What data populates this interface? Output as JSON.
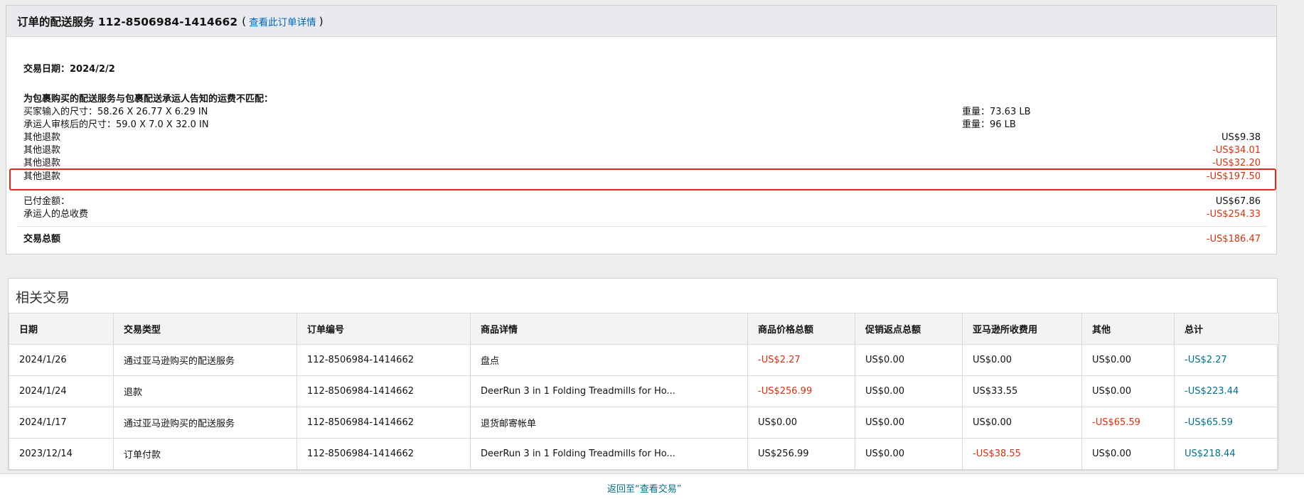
{
  "header": {
    "title": "订单的配送服务 112-8506984-1414662",
    "paren_open": "(",
    "link": "查看此订单详情",
    "paren_close": ")"
  },
  "summary": {
    "date_label": "交易日期：",
    "date_value": "2024/2/2",
    "mismatch_title": "为包裹购买的配送服务与包裹配送承运人告知的运费不匹配：",
    "buyer_dims": "买家输入的尺寸：58.26 X 26.77 X 6.29 IN",
    "buyer_weight": "重量：73.63 LB",
    "carrier_dims": "承运人审核后的尺寸：59.0 X 7.0 X 32.0 IN",
    "carrier_weight": "重量：96 LB",
    "refunds": [
      {
        "label": "其他退款",
        "amount": "US$9.38"
      },
      {
        "label": "其他退款",
        "amount": "-US$34.01"
      },
      {
        "label": "其他退款",
        "amount": "-US$32.20"
      },
      {
        "label": "其他退款",
        "amount": "-US$197.50"
      }
    ],
    "paid_label": "已付金额：",
    "paid_value": "US$67.86",
    "carrier_fee_label": "承运人的总收费",
    "carrier_fee_value": "-US$254.33",
    "total_label": "交易总额",
    "total_value": "-US$186.47"
  },
  "related": {
    "title": "相关交易",
    "columns": [
      "日期",
      "交易类型",
      "订单编号",
      "商品详情",
      "商品价格总额",
      "促销返点总额",
      "亚马逊所收费用",
      "其他",
      "总计"
    ],
    "rows": [
      [
        "2024/1/26",
        "通过亚马逊购买的配送服务",
        "112-8506984-1414662",
        "盘点",
        "-US$2.27",
        "US$0.00",
        "US$0.00",
        "US$0.00",
        "-US$2.27"
      ],
      [
        "2024/1/24",
        "退款",
        "112-8506984-1414662",
        "DeerRun 3 in 1 Folding Treadmills for Ho...",
        "-US$256.99",
        "US$0.00",
        "US$33.55",
        "US$0.00",
        "-US$223.44"
      ],
      [
        "2024/1/17",
        "通过亚马逊购买的配送服务",
        "112-8506984-1414662",
        "退货邮寄帐单",
        "US$0.00",
        "US$0.00",
        "US$0.00",
        "-US$65.59",
        "-US$65.59"
      ],
      [
        "2023/12/14",
        "订单付款",
        "112-8506984-1414662",
        "DeerRun 3 in 1 Folding Treadmills for Ho...",
        "US$256.99",
        "US$0.00",
        "-US$38.55",
        "US$0.00",
        "US$218.44"
      ]
    ]
  },
  "footer": {
    "back_link": "返回至“查看交易”"
  },
  "colors": {
    "negative": "#d13212",
    "link": "#007185",
    "highlight_border": "#e02a1d"
  }
}
